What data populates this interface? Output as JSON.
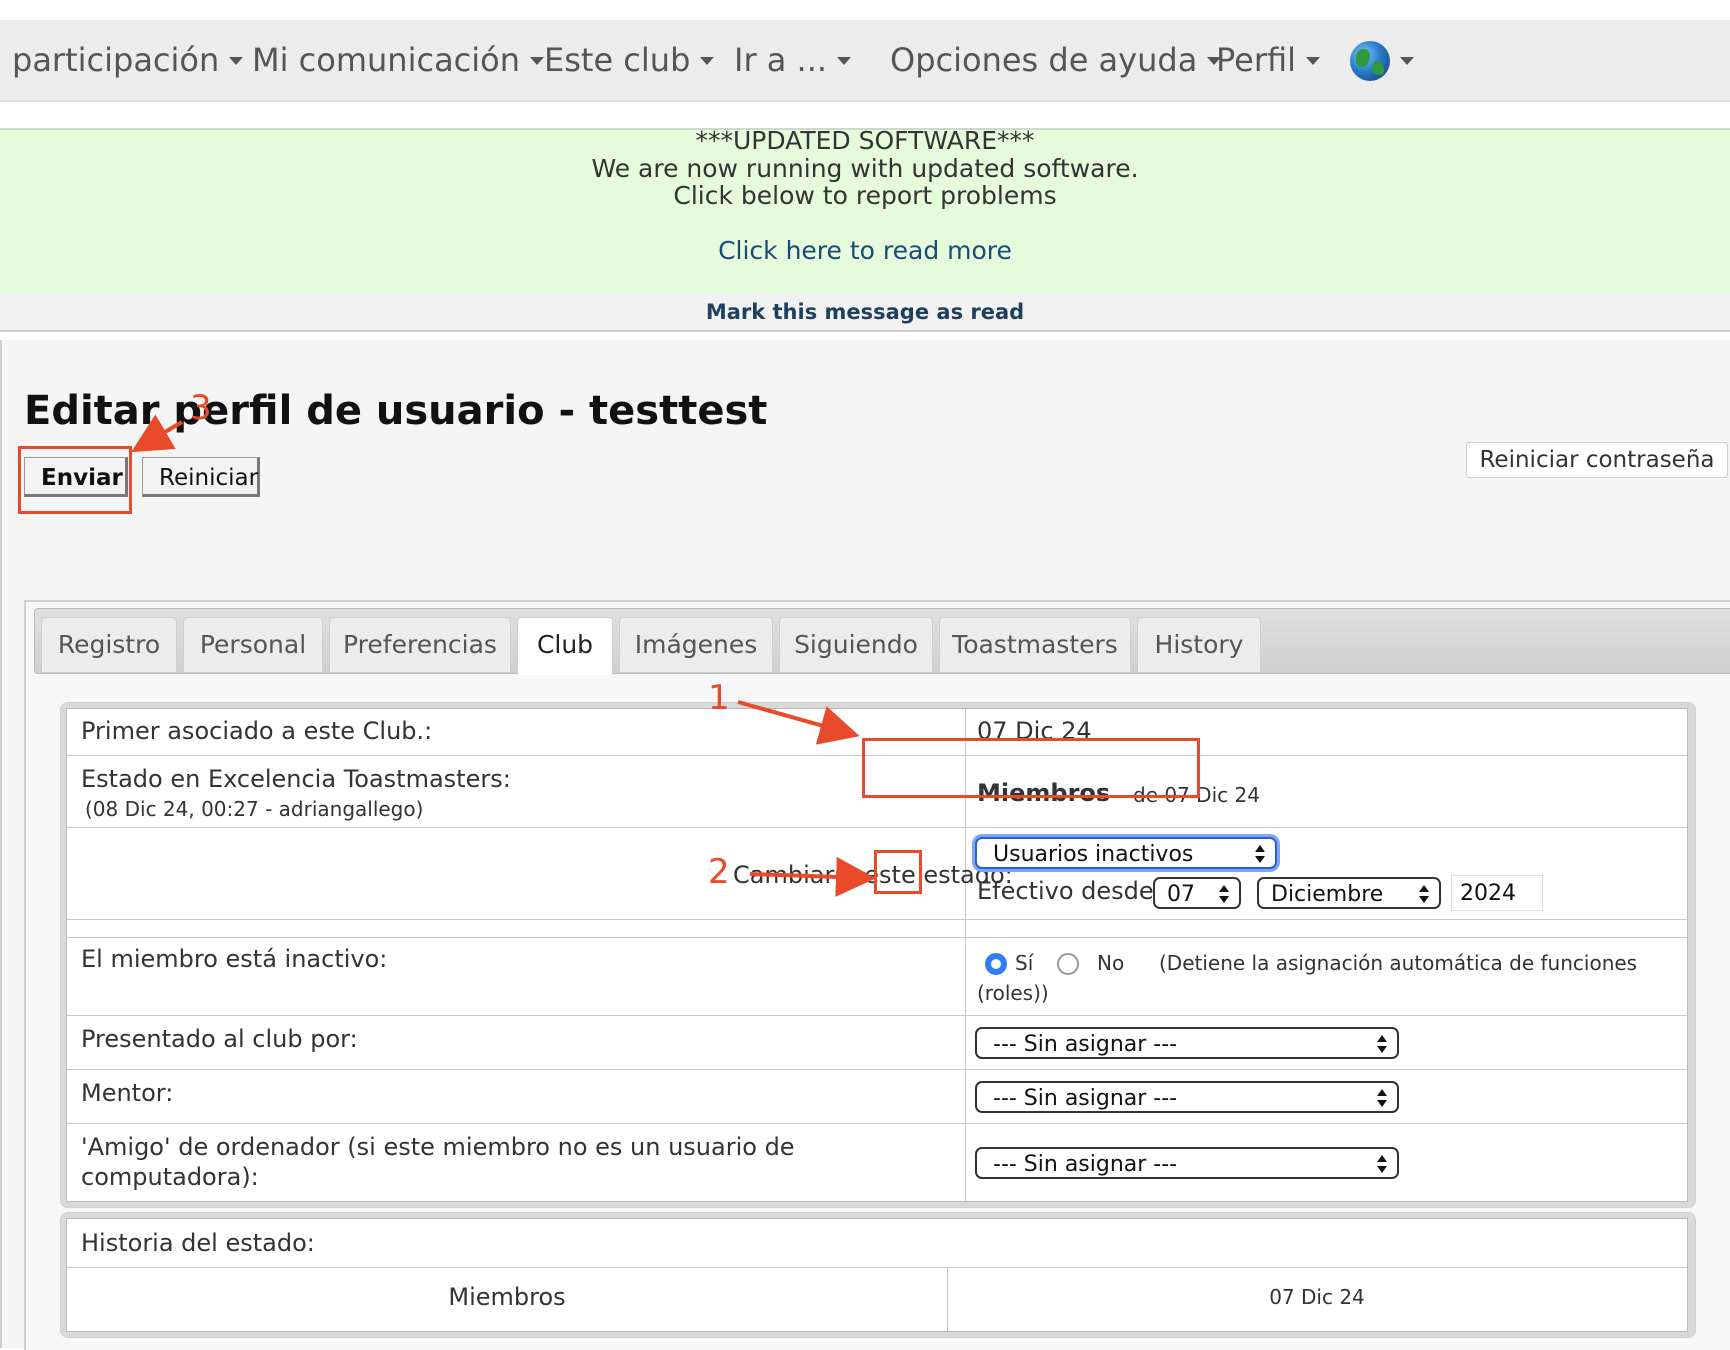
{
  "nav": {
    "items": [
      "participación",
      "Mi comunicación",
      "Este club",
      "Ir a ...",
      "Opciones de ayuda",
      "Perfil"
    ],
    "language_icon": "globe-icon"
  },
  "banner": {
    "line1": "***UPDATED SOFTWARE***",
    "line2": "We are now running with updated software.",
    "line3": "Click below to report problems",
    "link": "Click here to read more",
    "mark_read": "Mark this message as read"
  },
  "page": {
    "title": "Editar perfil de usuario - testtest",
    "submit_label": "Enviar",
    "reset_label": "Reiniciar",
    "reset_password_label": "Reiniciar contraseña"
  },
  "tabs": [
    {
      "label": "Registro"
    },
    {
      "label": "Personal"
    },
    {
      "label": "Preferencias"
    },
    {
      "label": "Club",
      "active": true
    },
    {
      "label": "Imágenes"
    },
    {
      "label": "Siguiendo"
    },
    {
      "label": "Toastmasters"
    },
    {
      "label": "History"
    }
  ],
  "form": {
    "first_assoc_label": "Primer asociado a este Club.:",
    "first_assoc_value": "07 Dic 24",
    "status_label": "Estado en Excelencia Toastmasters:",
    "status_sub": "(08 Dic 24, 00:27 - adriangallego)",
    "status_value": "Miembros",
    "status_since": "de 07 Dic 24",
    "change_label": "Cambiar a este estado:",
    "change_select": "Usuarios inactivos",
    "effective_label": "Efectivo desde:",
    "effective_day": "07",
    "effective_month": "Diciembre",
    "effective_year": "2024",
    "inactive_label": "El miembro está inactivo:",
    "inactive_yes": "Sí",
    "inactive_no": "No",
    "inactive_note": "(Detiene la asignación automática de funciones",
    "inactive_note2": "(roles))",
    "inactive_selected": "yes",
    "introduced_label": "Presentado al club por:",
    "introduced_value": "--- Sin asignar ---",
    "mentor_label": "Mentor:",
    "mentor_value": "--- Sin asignar ---",
    "buddy_label_1": "'Amigo' de ordenador (si este miembro no es un usuario de",
    "buddy_label_2": "computadora):",
    "buddy_value": "--- Sin asignar ---"
  },
  "history": {
    "label": "Historia del estado:",
    "rows": [
      {
        "status": "Miembros",
        "date": "07 Dic 24"
      }
    ]
  },
  "annotations": {
    "n1": "1",
    "n2": "2",
    "n3": "3",
    "color": "#e84a2a"
  },
  "colors": {
    "banner_bg": "#e6fbdc",
    "nav_bg": "#ececec",
    "radio_accent": "#2f7cf6"
  }
}
